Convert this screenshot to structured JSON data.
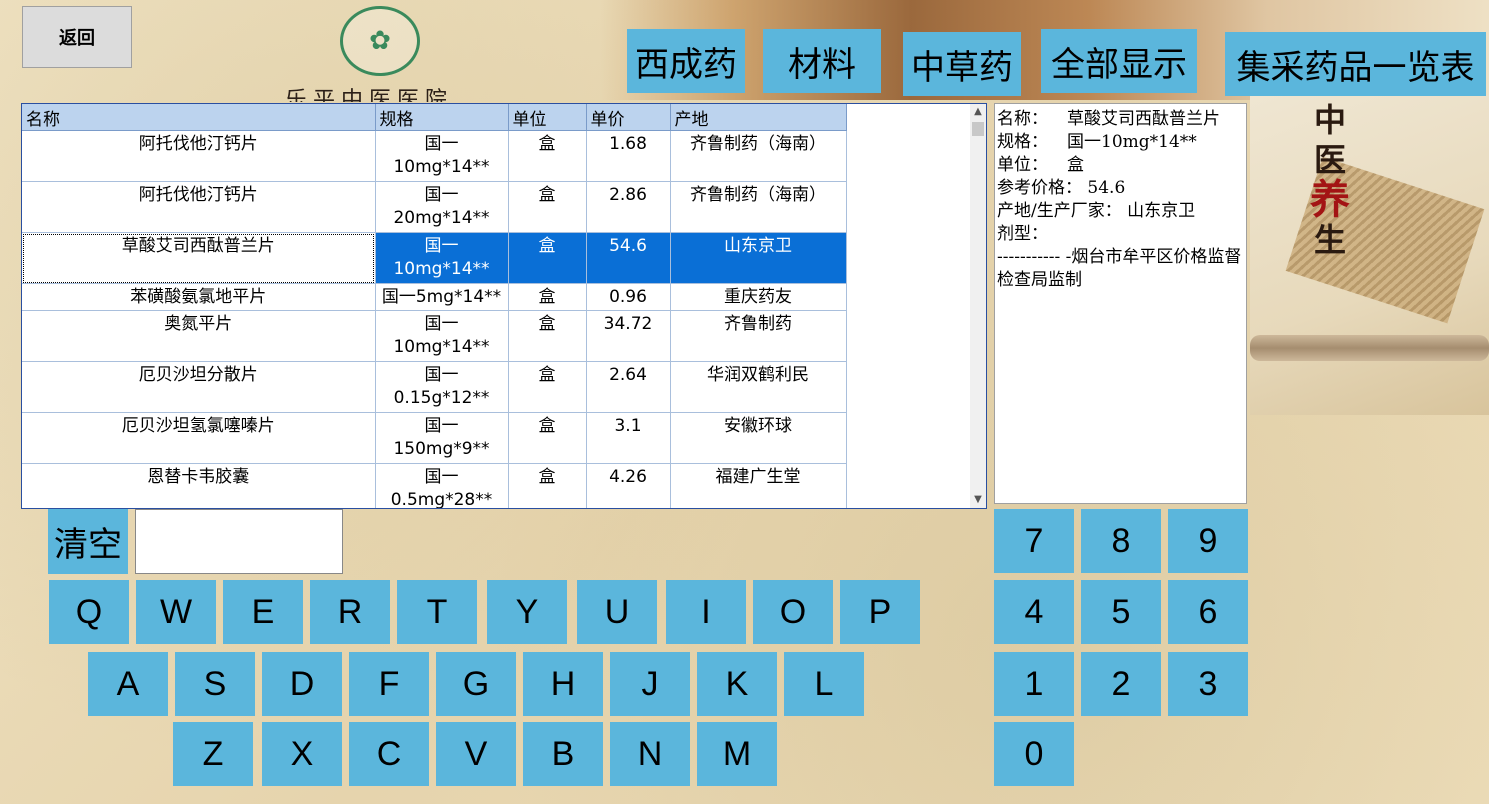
{
  "header": {
    "back_label": "返回",
    "hospital_name": "乐平中医医院"
  },
  "side_decoration": {
    "line1": "中",
    "line2": "医",
    "line3": "养",
    "line4": "生"
  },
  "categories": [
    {
      "label": "西成药"
    },
    {
      "label": "材料"
    },
    {
      "label": "中草药"
    },
    {
      "label": "全部显示"
    },
    {
      "label": "集采药品一览表"
    }
  ],
  "table": {
    "columns": [
      "名称",
      "规格",
      "单位",
      "单价",
      "产地"
    ],
    "rows": [
      {
        "name": "阿托伐他汀钙片",
        "spec_line1": "国一",
        "spec_line2": "10mg*14**",
        "unit": "盒",
        "price": "1.68",
        "origin": "齐鲁制药（海南）"
      },
      {
        "name": "阿托伐他汀钙片",
        "spec_line1": "国一",
        "spec_line2": "20mg*14**",
        "unit": "盒",
        "price": "2.86",
        "origin": "齐鲁制药（海南）"
      },
      {
        "name": "草酸艾司西酞普兰片",
        "spec_line1": "国一",
        "spec_line2": "10mg*14**",
        "unit": "盒",
        "price": "54.6",
        "origin": "山东京卫"
      },
      {
        "name": "苯磺酸氨氯地平片",
        "spec_line1": "国一5mg*14**",
        "spec_line2": "",
        "unit": "盒",
        "price": "0.96",
        "origin": "重庆药友"
      },
      {
        "name": "奥氮平片",
        "spec_line1": "国一",
        "spec_line2": "10mg*14**",
        "unit": "盒",
        "price": "34.72",
        "origin": "齐鲁制药"
      },
      {
        "name": "厄贝沙坦分散片",
        "spec_line1": "国一",
        "spec_line2": "0.15g*12**",
        "unit": "盒",
        "price": "2.64",
        "origin": "华润双鹤利民"
      },
      {
        "name": "厄贝沙坦氢氯噻嗪片",
        "spec_line1": "国一",
        "spec_line2": "150mg*9**",
        "unit": "盒",
        "price": "3.1",
        "origin": "安徽环球"
      },
      {
        "name": "恩替卡韦胶囊",
        "spec_line1": "国一",
        "spec_line2": "0.5mg*28**",
        "unit": "盒",
        "price": "4.26",
        "origin": "福建广生堂"
      }
    ]
  },
  "detail": {
    "name_label": "名称：",
    "name_value": "草酸艾司西酞普兰片",
    "spec_label": "规格：",
    "spec_value": "国一10mg*14**",
    "unit_label": "单位：",
    "unit_value": "盒",
    "price_label": "参考价格：",
    "price_value": "54.6",
    "origin_label": "产地/生产厂家：",
    "origin_value": "山东京卫",
    "form_label": "剂型：",
    "note": "----------- -烟台市牟平区价格监督检查局监制"
  },
  "keyboard": {
    "clear_label": "清空",
    "search_value": "",
    "row1": [
      "Q",
      "W",
      "E",
      "R",
      "T",
      "Y",
      "U",
      "I",
      "O",
      "P"
    ],
    "row2": [
      "A",
      "S",
      "D",
      "F",
      "G",
      "H",
      "J",
      "K",
      "L"
    ],
    "row3": [
      "Z",
      "X",
      "C",
      "V",
      "B",
      "N",
      "M"
    ],
    "numpad": [
      "7",
      "8",
      "9",
      "4",
      "5",
      "6",
      "1",
      "2",
      "3",
      "0"
    ]
  }
}
